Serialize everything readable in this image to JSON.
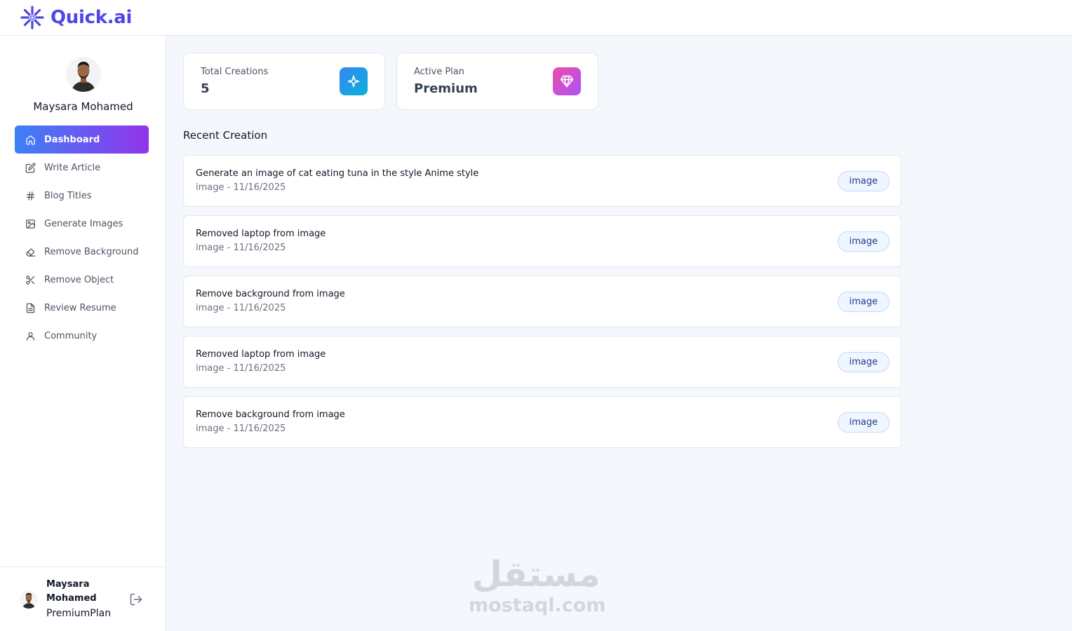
{
  "app": {
    "name": "Quick.ai",
    "brand_color": "#4f46e5"
  },
  "user": {
    "name": "Maysara Mohamed",
    "footer_name": "Maysara Mohamed",
    "plan": "PremiumPlan"
  },
  "sidebar": {
    "items": [
      {
        "label": "Dashboard",
        "icon": "home-icon",
        "active": true
      },
      {
        "label": "Write Article",
        "icon": "edit-icon"
      },
      {
        "label": "Blog Titles",
        "icon": "hash-icon"
      },
      {
        "label": "Generate Images",
        "icon": "image-icon"
      },
      {
        "label": "Remove Background",
        "icon": "eraser-icon"
      },
      {
        "label": "Remove Object",
        "icon": "scissors-icon"
      },
      {
        "label": "Review Resume",
        "icon": "file-text-icon"
      },
      {
        "label": "Community",
        "icon": "user-icon"
      }
    ],
    "active_gradient": [
      "#3c81f6",
      "#9234ea"
    ]
  },
  "stats": {
    "total_creations": {
      "label": "Total Creations",
      "value": "5",
      "icon": "sparkle-icon",
      "color": "#3b9be8"
    },
    "active_plan": {
      "label": "Active Plan",
      "value": "Premium",
      "icon": "gem-icon",
      "color": "#d946ef"
    }
  },
  "recent": {
    "title": "Recent Creation",
    "items": [
      {
        "title": "Generate an image of cat eating tuna in the style Anime style",
        "meta": "image - 11/16/2025",
        "tag": "image"
      },
      {
        "title": "Removed laptop from image",
        "meta": "image - 11/16/2025",
        "tag": "image"
      },
      {
        "title": "Remove background from image",
        "meta": "image - 11/16/2025",
        "tag": "image"
      },
      {
        "title": "Removed laptop from image",
        "meta": "image - 11/16/2025",
        "tag": "image"
      },
      {
        "title": "Remove background from image",
        "meta": "image - 11/16/2025",
        "tag": "image"
      }
    ]
  },
  "watermark": {
    "arabic": "مستقل",
    "latin": "mostaql.com"
  }
}
